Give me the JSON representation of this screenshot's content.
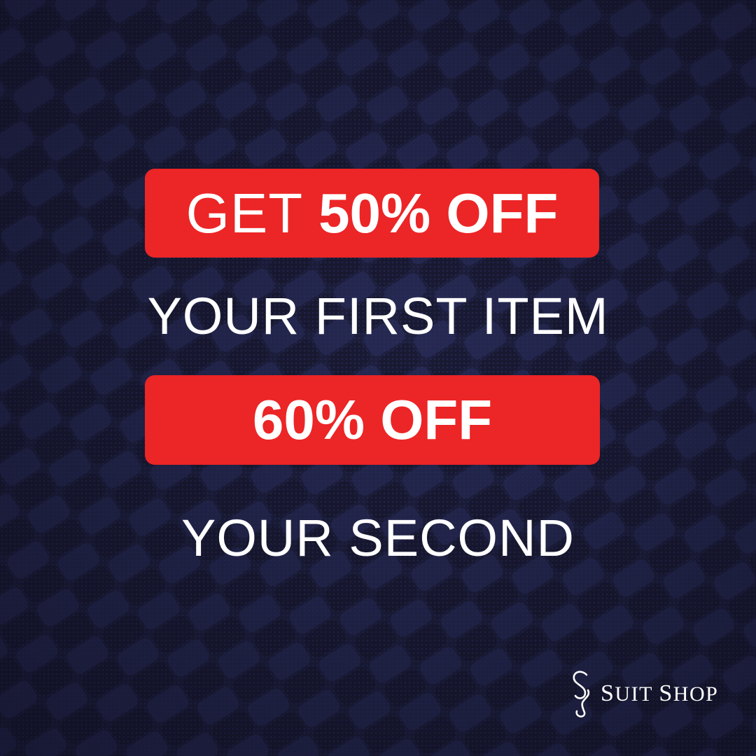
{
  "background": {
    "color": "#1c1e3a",
    "texture": "navy cable-knit wool"
  },
  "accent_color": "#ec2526",
  "offer1": {
    "prefix": "GET",
    "discount": "50% OFF"
  },
  "line1": "YOUR FIRST ITEM",
  "offer2": {
    "discount": "60% OFF"
  },
  "line2": "YOUR SECOND",
  "brand": {
    "initial1": "S",
    "rest1": "UIT",
    "initial2": "S",
    "rest2": "HOP",
    "icon": "ss-monogram-icon"
  }
}
